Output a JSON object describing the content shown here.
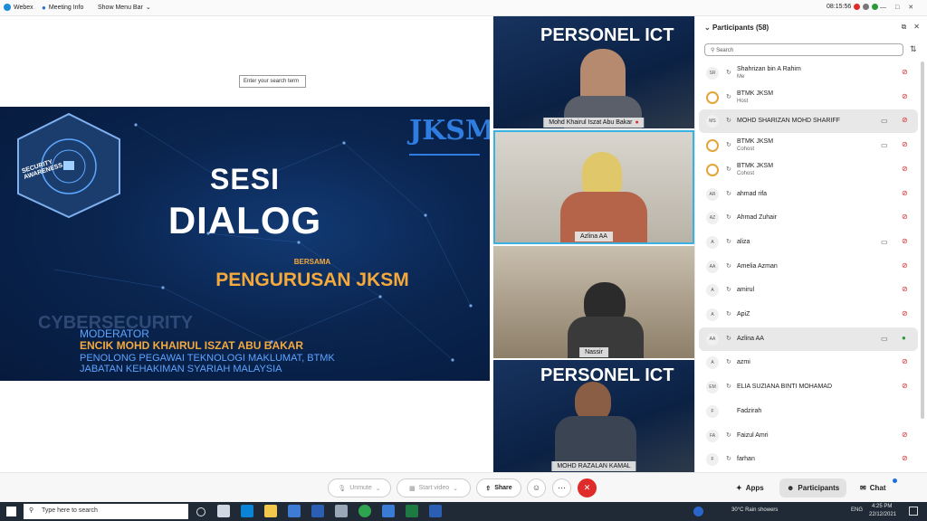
{
  "topbar": {
    "app_name": "Webex",
    "meeting_info": "Meeting Info",
    "show_menu_bar": "Show Menu Bar",
    "time": "08:15:56"
  },
  "stage": {
    "search_tooltip": "Enter your search term"
  },
  "slide": {
    "logo_text": "JKSM",
    "badge_text": "SECURITY AWARENESS",
    "watermark": "CYBERSECURITY",
    "title_line1": "SESI",
    "title_line2": "DIALOG",
    "bersama": "BERSAMA",
    "pengurusan": "PENGURUSAN JKSM",
    "moderator_label": "MODERATOR",
    "moderator_name": "ENCIK MOHD KHAIRUL ISZAT ABU BAKAR",
    "moderator_line1": "PENOLONG PEGAWAI TEKNOLOGI MAKLUMAT, BTMK",
    "moderator_line2": "JABATAN KEHAKIMAN SYARIAH MALAYSIA"
  },
  "video_tiles": [
    {
      "name": "Mohd Khairul Iszat Abu Bakar",
      "bg_text": "PERSONEL ICT"
    },
    {
      "name": "Azlina AA"
    },
    {
      "name": "Nassir"
    },
    {
      "name": "MOHD RAZALAN KAMAL",
      "bg_text": "PERSONEL ICT"
    }
  ],
  "participants": {
    "title": "Participants (58)",
    "search_placeholder": "Search",
    "list": [
      {
        "initials": "SR",
        "name": "Shahrizan bin A Rahim",
        "role": "Me",
        "mic": "muted"
      },
      {
        "initials": "",
        "name": "BTMK JKSM",
        "role": "Host",
        "mic": "muted",
        "logo": true
      },
      {
        "initials": "MS",
        "name": "MOHD SHARIZAN MOHD SHARIFF",
        "role": "",
        "mic": "muted",
        "cam": true,
        "selected": true
      },
      {
        "initials": "",
        "name": "BTMK JKSM",
        "role": "Cohost",
        "mic": "muted",
        "cam": true,
        "logo": true
      },
      {
        "initials": "",
        "name": "BTMK JKSM",
        "role": "Cohost",
        "mic": "muted",
        "logo": true
      },
      {
        "initials": "AR",
        "name": "ahmad rifa",
        "role": "",
        "mic": "muted"
      },
      {
        "initials": "AZ",
        "name": "Ahmad Zuhair",
        "role": "",
        "mic": "muted"
      },
      {
        "initials": "A",
        "name": "aliza",
        "role": "",
        "mic": "muted",
        "cam": true
      },
      {
        "initials": "AA",
        "name": "Amelia Azman",
        "role": "",
        "mic": "muted"
      },
      {
        "initials": "A",
        "name": "amirul",
        "role": "",
        "mic": "muted"
      },
      {
        "initials": "A",
        "name": "ApiZ",
        "role": "",
        "mic": "muted"
      },
      {
        "initials": "AA",
        "name": "Azlina AA",
        "role": "",
        "mic": "on",
        "cam": true,
        "selected": true
      },
      {
        "initials": "A",
        "name": "azmi",
        "role": "",
        "mic": "muted"
      },
      {
        "initials": "EM",
        "name": "ELIA SUZIANA BINTI MOHAMAD",
        "role": "",
        "mic": "muted"
      },
      {
        "initials": "F",
        "name": "Fadzirah",
        "role": "",
        "mic": "none",
        "noicon": true
      },
      {
        "initials": "FA",
        "name": "Faizul Amri",
        "role": "",
        "mic": "muted"
      },
      {
        "initials": "F",
        "name": "farhan",
        "role": "",
        "mic": "muted"
      }
    ]
  },
  "controls": {
    "unmute": "Unmute",
    "start_video": "Start video",
    "share": "Share",
    "apps": "Apps",
    "participants": "Participants",
    "chat": "Chat"
  },
  "taskbar": {
    "search_placeholder": "Type here to search",
    "weather": "30°C  Rain showers",
    "lang": "ENG",
    "time": "4:25 PM",
    "date": "22/12/2021"
  }
}
